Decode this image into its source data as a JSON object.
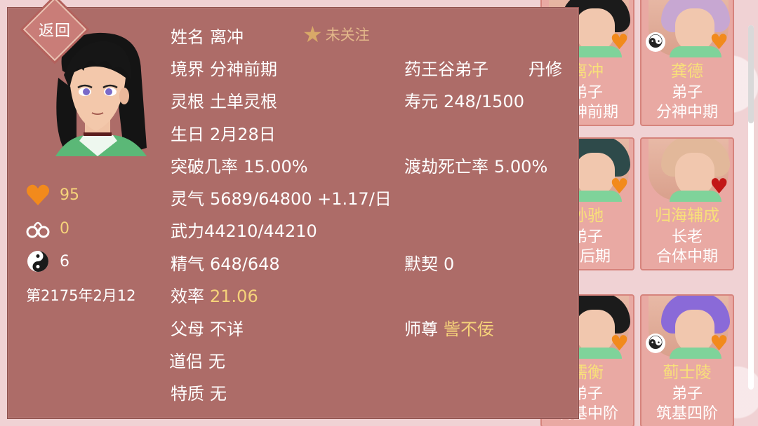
{
  "background_cards": [
    {
      "name": "离冲",
      "role": "弟子",
      "rank": "分神前期",
      "hair": "#1b1b1b",
      "heart": "orange",
      "col": 3,
      "row": 0,
      "clip": true
    },
    {
      "name": "龚德",
      "role": "弟子",
      "rank": "分神中期",
      "hair": "#c7a7d2",
      "heart": "orange",
      "col": 4,
      "row": 0,
      "yinyang": true
    },
    {
      "name": "孙驰",
      "role": "弟子",
      "rank": "丹后期",
      "hair": "#2e4a4a",
      "heart": "orange",
      "col": 3,
      "row": 1,
      "clip": true
    },
    {
      "name": "归海辅成",
      "role": "长老",
      "rank": "合体中期",
      "hair": "#e2b89a",
      "heart": "red",
      "col": 4,
      "row": 1
    },
    {
      "name": "儒衡",
      "role": "弟子",
      "rank": "筑基中阶",
      "hair": "#1b1b1b",
      "heart": "orange",
      "col": 3,
      "row": 2,
      "clip": true
    },
    {
      "name": "蓟士陵",
      "role": "弟子",
      "rank": "筑基四阶",
      "hair": "#8a6ad8",
      "heart": "orange",
      "col": 4,
      "row": 2,
      "yinyang": true
    }
  ],
  "back_button": "返回",
  "follow": {
    "label": "未关注",
    "icon": "star-icon"
  },
  "stats": {
    "affection": "95",
    "bonds": "0",
    "dao": "6"
  },
  "date": "第2175年2月12",
  "info": {
    "name_label": "姓名",
    "name": "离冲",
    "realm_label": "境界",
    "realm": "分神前期",
    "sect": "药王谷弟子",
    "profession": "丹修",
    "root_label": "灵根",
    "root": "土单灵根",
    "lifespan_label": "寿元",
    "lifespan": "248/1500",
    "birthday_label": "生日",
    "birthday": "2月28日",
    "breakthrough_label": "突破几率",
    "breakthrough": "15.00%",
    "tribulation_label": "渡劫死亡率",
    "tribulation": "5.00%",
    "qi_label": "灵气",
    "qi": "5689/64800 +1.17/日",
    "force_label": "武力",
    "force": "44210/44210",
    "essence_label": "精气",
    "essence": "648/648",
    "tacit_label": "默契",
    "tacit": "0",
    "efficiency_label": "效率",
    "efficiency": "21.06",
    "parents_label": "父母",
    "parents": "不详",
    "master_label": "师尊",
    "master": "訾不佞",
    "partner_label": "道侣",
    "partner": "无",
    "trait_label": "特质",
    "trait": "无"
  },
  "colors": {
    "panel": "#ad6c68",
    "accent_yellow": "#f6d37a",
    "heart_orange": "#f28a1c",
    "heart_red": "#c21616"
  }
}
